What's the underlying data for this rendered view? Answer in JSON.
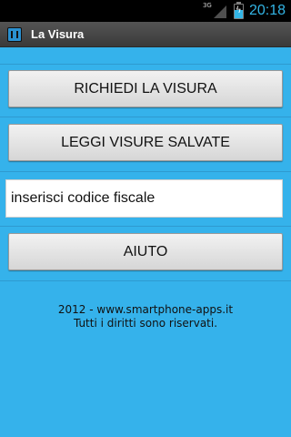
{
  "status_bar": {
    "network_label": "3G",
    "time": "20:18",
    "icons": [
      "signal-icon",
      "battery-charging-icon"
    ],
    "battery_level_percent": 55
  },
  "app_bar": {
    "title": "La Visura",
    "icon": "app-icon"
  },
  "buttons": {
    "richiedi": "RICHIEDI LA VISURA",
    "leggi": "LEGGI VISURE SALVATE",
    "aiuto": "AIUTO"
  },
  "codice_fiscale": {
    "placeholder": "inserisci codice fiscale",
    "value": ""
  },
  "footer": {
    "line1": "2012 - www.smartphone-apps.it",
    "line2": "Tutti i diritti sono riservati."
  },
  "colors": {
    "background": "#35b2eb",
    "status_accent": "#33b5e5",
    "title_bar": "#444444"
  }
}
